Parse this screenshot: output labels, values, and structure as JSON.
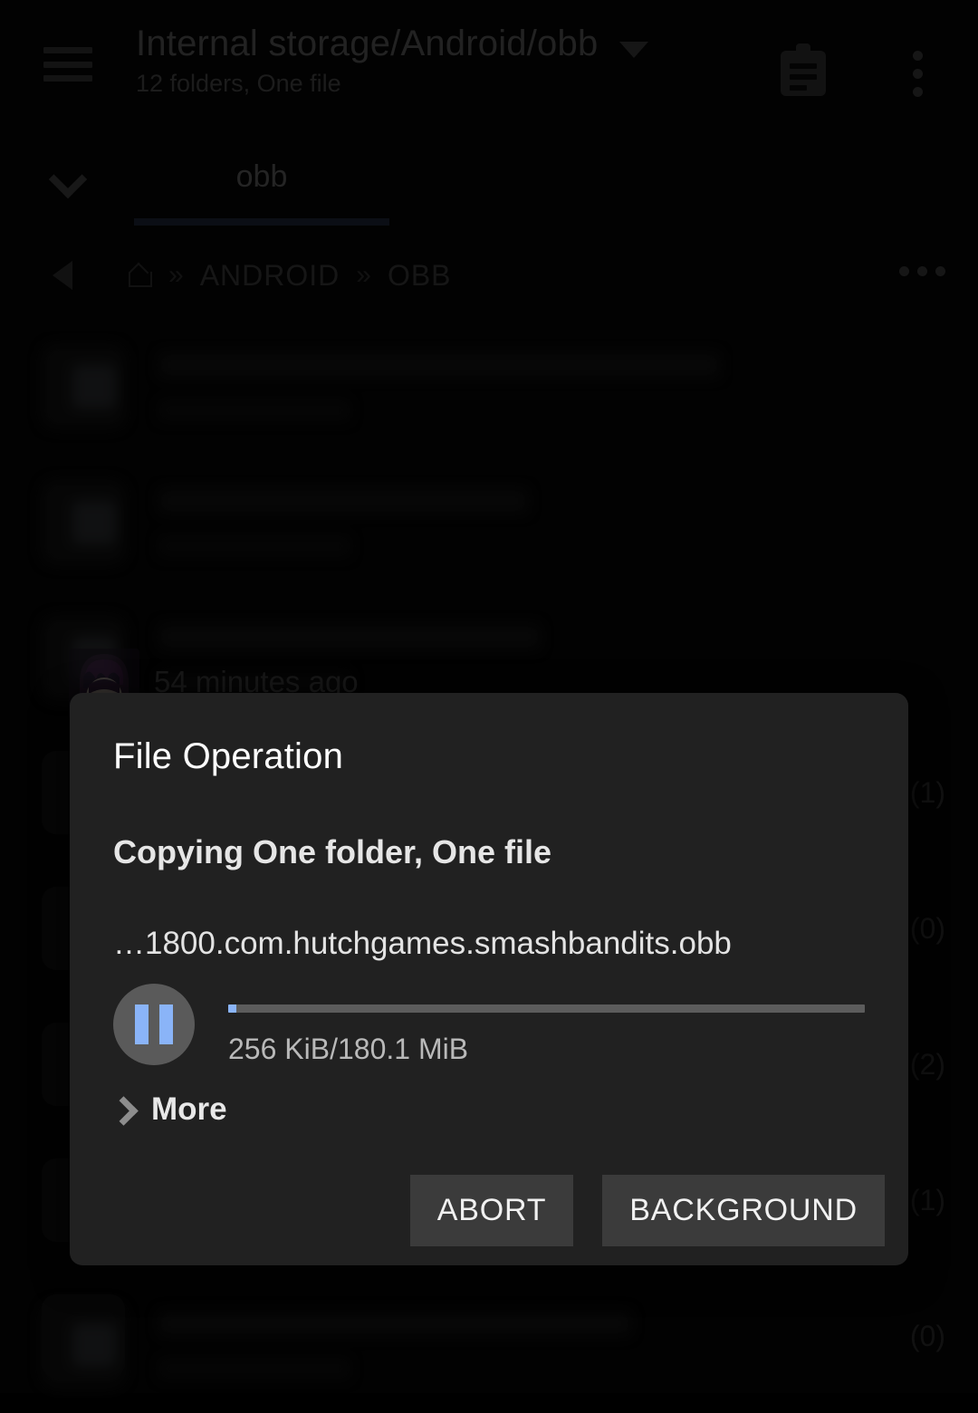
{
  "toolbar": {
    "menu_icon": "hamburger-icon",
    "title": "Internal storage/Android/obb",
    "subtitle": "12 folders, One file",
    "title_caret_icon": "chevron-down-icon",
    "clipboard_icon": "clipboard-icon",
    "overflow_icon": "more-vertical-icon"
  },
  "tabs": {
    "expand_icon": "chevron-down-icon",
    "items": [
      {
        "label": "obb",
        "active": true
      }
    ]
  },
  "breadcrumb": {
    "back_icon": "back-triangle-icon",
    "home_icon": "home-icon",
    "separator": "»",
    "items": [
      {
        "label": "ANDROID"
      },
      {
        "label": "OBB"
      }
    ],
    "overflow_icon": "more-horizontal-icon"
  },
  "file_list": {
    "rows": [
      {
        "count": ""
      },
      {
        "count": ""
      },
      {
        "count": ""
      },
      {
        "count": "(1)"
      },
      {
        "count": "(0)"
      },
      {
        "count": "(2)"
      },
      {
        "count": "(1)"
      },
      {
        "count": "(0)"
      }
    ],
    "timestamp": "54 minutes ago"
  },
  "dialog": {
    "title": "File Operation",
    "operation": "Copying One folder, One file",
    "current_file": "…1800.com.hutchgames.smashbandits.obb",
    "pause_icon": "pause-icon",
    "progress": {
      "percent": 0.14,
      "transferred": "256 KiB",
      "total": "180.1 MiB",
      "text": "256 KiB/180.1 MiB",
      "fill_color": "#8ab4f8",
      "track_color": "#5c5c5c"
    },
    "more": {
      "label": "More",
      "chevron_icon": "chevron-right-icon"
    },
    "buttons": [
      {
        "label": "ABORT",
        "name": "abort-button"
      },
      {
        "label": "BACKGROUND",
        "name": "background-button"
      }
    ]
  }
}
